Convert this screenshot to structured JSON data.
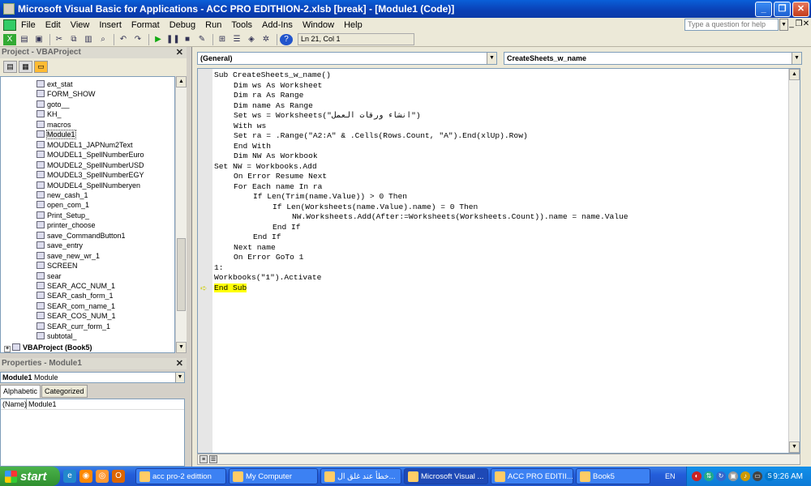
{
  "window": {
    "title": "Microsoft Visual Basic for Applications - ACC PRO EDITHION-2.xlsb [break] - [Module1 (Code)]",
    "controls": [
      "_",
      "❐",
      "✕"
    ]
  },
  "menubar": {
    "items": [
      "File",
      "Edit",
      "View",
      "Insert",
      "Format",
      "Debug",
      "Run",
      "Tools",
      "Add-Ins",
      "Window",
      "Help"
    ],
    "ask_placeholder": "Type a question for help",
    "mdi_controls": [
      "_",
      "❐",
      "✕"
    ]
  },
  "toolbar": {
    "position_label": "Ln 21, Col 1"
  },
  "project_pane": {
    "title": "Project - VBAProject",
    "close": "✕",
    "items": [
      "ext_stat",
      "FORM_SHOW",
      "goto__",
      "KH_",
      "macros",
      "Module1",
      "MOUDEL1_JAPNum2Text",
      "MOUDEL1_SpellNumberEuro",
      "MOUDEL2_SpellNumberUSD",
      "MOUDEL3_SpellNumberEGY",
      "MOUDEL4_SpellNumberyen",
      "new_cash_1",
      "open_com_1",
      "Print_Setup_",
      "printer_choose",
      "save_CommandButton1",
      "save_entry",
      "save_new_wr_1",
      "SCREEN",
      "sear",
      "SEAR_ACC_NUM_1",
      "SEAR_cash_form_1",
      "SEAR_com_name_1",
      "SEAR_COS_NUM_1",
      "SEAR_curr_form_1",
      "subtotal_"
    ],
    "selected_item": "Module1",
    "root_project": "VBAProject (Book5)"
  },
  "properties_pane": {
    "title": "Properties - Module1",
    "close": "✕",
    "object_name": "Module1",
    "object_type": "Module",
    "tabs": [
      "Alphabetic",
      "Categorized"
    ],
    "active_tab": "Alphabetic",
    "rows": [
      {
        "key": "(Name)",
        "value": "Module1"
      }
    ]
  },
  "code_window": {
    "object_combo": "(General)",
    "proc_combo": "CreateSheets_w_name",
    "current_line_index": 21,
    "lines": [
      {
        "text": "Sub CreateSheets_w_name()",
        "indent": 0
      },
      {
        "text": "Dim ws As Worksheet",
        "indent": 1
      },
      {
        "text": "Dim ra As Range",
        "indent": 1
      },
      {
        "text": "Dim name As Range",
        "indent": 1
      },
      {
        "text": "Set ws = Worksheets(\"انشاء ورقات العمل\")",
        "indent": 1
      },
      {
        "text": "With ws",
        "indent": 1
      },
      {
        "text": "Set ra = .Range(\"A2:A\" & .Cells(Rows.Count, \"A\").End(xlUp).Row)",
        "indent": 1
      },
      {
        "text": "End With",
        "indent": 1
      },
      {
        "text": "Dim NW As Workbook",
        "indent": 1
      },
      {
        "text": "Set NW = Workbooks.Add",
        "indent": 0
      },
      {
        "text": "On Error Resume Next",
        "indent": 1
      },
      {
        "text": "For Each name In ra",
        "indent": 1
      },
      {
        "text": "If Len(Trim(name.Value)) > 0 Then",
        "indent": 2
      },
      {
        "text": "If Len(Worksheets(name.Value).name) = 0 Then",
        "indent": 3
      },
      {
        "text": "NW.Worksheets.Add(After:=Worksheets(Worksheets.Count)).name = name.Value",
        "indent": 4
      },
      {
        "text": "End If",
        "indent": 3
      },
      {
        "text": "End If",
        "indent": 2
      },
      {
        "text": "Next name",
        "indent": 1
      },
      {
        "text": "On Error GoTo 1",
        "indent": 1
      },
      {
        "text": "1:",
        "indent": 0
      },
      {
        "text": "Workbooks(\"1\").Activate",
        "indent": 0
      },
      {
        "text": "End Sub",
        "indent": 0
      }
    ]
  },
  "taskbar": {
    "start_label": "start",
    "tasks": [
      {
        "label": "acc pro-2 edittion",
        "active": false
      },
      {
        "label": "My Computer",
        "active": false
      },
      {
        "label": "خطأ عند غلق ال...",
        "active": false
      },
      {
        "label": "Microsoft Visual ...",
        "active": true
      },
      {
        "label": "ACC PRO EDITII...",
        "active": false
      },
      {
        "label": "Book5",
        "active": false
      }
    ],
    "language": "EN",
    "clock": "9:26 AM"
  },
  "colors": {
    "titlebar": "#0a4fd0",
    "highlight": "#ffff00",
    "keyword": "#00008b"
  }
}
